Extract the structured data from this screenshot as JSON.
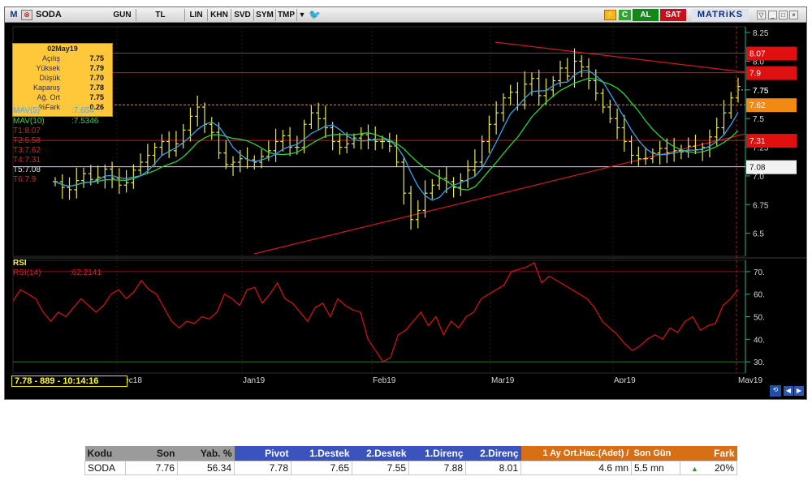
{
  "toolbar": {
    "logo": "M",
    "symbol": "SODA",
    "buttons": [
      "GUN",
      "TL",
      "LIN",
      "KHN",
      "SVD",
      "SYM",
      "TMP"
    ],
    "al": "AL",
    "sat": "SAT",
    "brand": "MATRiKS",
    "c_label": "C"
  },
  "infobox": {
    "date": "02May19",
    "rows": [
      {
        "label": "Açılış",
        "value": "7.75"
      },
      {
        "label": "Yüksek",
        "value": "7.79"
      },
      {
        "label": "Düşük",
        "value": "7.70"
      },
      {
        "label": "Kapanış",
        "value": "7.78"
      },
      {
        "label": "Ağ. Ort",
        "value": "7.75"
      },
      {
        "label": "%Fark",
        "value": "0.26"
      }
    ]
  },
  "legend": {
    "mav5_label": "MAV(5)",
    "mav5_value": ":7.654",
    "mav10_label": "MAV(10)",
    "mav10_value": ":7.5346",
    "targets": [
      "T1:8.07",
      "T2:5.58",
      "T3:7.62",
      "T4:7.31",
      "T5:7.08",
      "T6:7.9"
    ]
  },
  "rsi_legend": {
    "title": "RSI",
    "label": "RSI(14)",
    "value": ":62.2141"
  },
  "status_text": "7.78 - 889 - 10:14:16",
  "colors": {
    "price_bars": "#e8e84a",
    "mav5": "#3aa0e6",
    "mav10": "#2fcf3f",
    "trendline": "#d01b1b",
    "rsi_line": "#cc1414",
    "level_orange": "#f28a12",
    "level_red": "#e01010"
  },
  "chart_data": [
    {
      "type": "ohlc",
      "x_labels": [
        "Dec18",
        "Jan19",
        "Feb19",
        "Mar19",
        "Apr19",
        "May19"
      ],
      "y_ticks": [
        6.5,
        6.75,
        7.0,
        7.25,
        7.5,
        7.75,
        8.0,
        8.25
      ],
      "ylim": [
        6.3,
        8.3
      ],
      "closes": [
        6.95,
        6.9,
        6.88,
        6.96,
        7.02,
        6.97,
        6.99,
        7.06,
        6.98,
        6.92,
        6.94,
        7.05,
        7.12,
        7.18,
        7.25,
        7.3,
        7.22,
        7.28,
        7.4,
        7.52,
        7.6,
        7.45,
        7.38,
        7.2,
        7.1,
        7.12,
        7.15,
        7.14,
        7.12,
        7.17,
        7.22,
        7.3,
        7.35,
        7.25,
        7.25,
        7.45,
        7.55,
        7.5,
        7.42,
        7.3,
        7.25,
        7.28,
        7.33,
        7.36,
        7.32,
        7.3,
        7.3,
        7.26,
        7.12,
        6.85,
        6.62,
        6.7,
        6.85,
        6.92,
        6.98,
        6.95,
        6.9,
        6.96,
        7.05,
        7.12,
        7.3,
        7.45,
        7.55,
        7.68,
        7.73,
        7.62,
        7.8,
        7.85,
        7.7,
        7.75,
        7.83,
        7.94,
        7.87,
        8.0,
        7.95,
        7.83,
        7.72,
        7.6,
        7.5,
        7.42,
        7.3,
        7.18,
        7.15,
        7.15,
        7.2,
        7.24,
        7.2,
        7.22,
        7.21,
        7.26,
        7.23,
        7.25,
        7.34,
        7.42,
        7.55,
        7.68,
        7.78
      ],
      "series": [
        {
          "name": "MAV(5)",
          "last": 7.654
        },
        {
          "name": "MAV(10)",
          "last": 7.5346
        }
      ],
      "levels": [
        {
          "name": "T1",
          "value": 8.07,
          "label": "8.07",
          "color": "red"
        },
        {
          "name": "T6",
          "value": 7.9,
          "label": "7.9",
          "color": "red"
        },
        {
          "name": "T3",
          "value": 7.62,
          "label": "7.62",
          "color": "orange"
        },
        {
          "name": "T4",
          "value": 7.31,
          "label": "7.31",
          "color": "red"
        },
        {
          "name": "T5",
          "value": 7.08,
          "label": "7.08",
          "color": "white"
        }
      ],
      "last_label": "7.75"
    },
    {
      "type": "line",
      "name": "RSI(14)",
      "y_ticks": [
        30,
        40,
        50,
        60,
        70
      ],
      "ylim": [
        25,
        75
      ],
      "values": [
        57,
        62,
        60,
        58,
        52,
        48,
        52,
        50,
        54,
        58,
        55,
        52,
        55,
        60,
        62,
        58,
        61,
        66,
        62,
        60,
        54,
        48,
        45,
        48,
        47,
        50,
        49,
        52,
        60,
        58,
        55,
        62,
        63,
        56,
        60,
        65,
        58,
        56,
        52,
        48,
        54,
        56,
        50,
        58,
        55,
        53,
        52,
        40,
        35,
        30,
        32,
        42,
        44,
        48,
        52,
        46,
        50,
        42,
        48,
        45,
        50,
        52,
        58,
        60,
        62,
        64,
        70,
        71,
        72,
        74,
        65,
        68,
        66,
        64,
        62,
        60,
        58,
        54,
        48,
        45,
        42,
        38,
        35,
        37,
        40,
        42,
        40,
        45,
        43,
        48,
        50,
        44,
        46,
        47,
        55,
        58,
        62
      ]
    }
  ],
  "table": {
    "headers": [
      "Kodu",
      "Son",
      "Yab. %",
      "Pivot",
      "1.Destek",
      "2.Destek",
      "1.Direnç",
      "2.Direnç",
      "1 Ay Ort.Hac.(Adet)  /",
      "Son Gün",
      "Fark"
    ],
    "row": [
      "SODA",
      "7.76",
      "56.34",
      "7.78",
      "7.65",
      "7.55",
      "7.88",
      "8.01",
      "4.6 mn",
      "5.5 mn",
      "20%"
    ]
  }
}
